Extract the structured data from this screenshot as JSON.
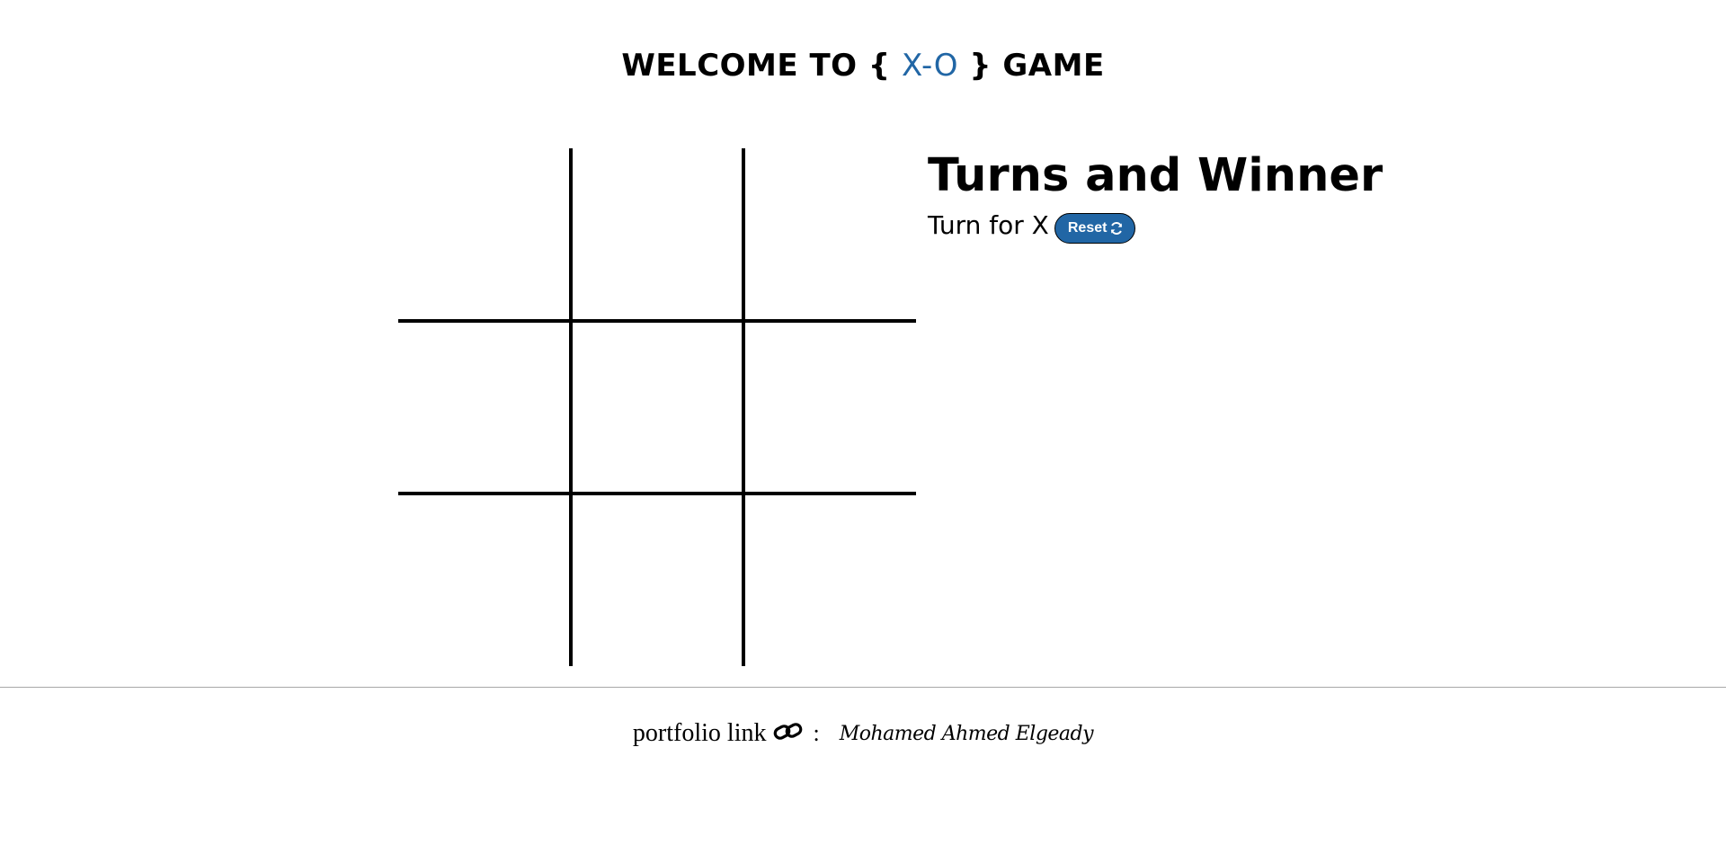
{
  "header": {
    "title_before": "WELCOME TO { ",
    "title_accent": "X-O",
    "title_after": " } GAME",
    "accent_color": "#2166a5"
  },
  "board": {
    "cells": [
      "",
      "",
      "",
      "",
      "",
      "",
      "",
      "",
      ""
    ]
  },
  "status_panel": {
    "heading": "Turns and Winner",
    "turn_text": "Turn for X",
    "reset_label": "Reset",
    "reset_icon": "refresh-icon",
    "button_color": "#2166a5"
  },
  "footer": {
    "label": "portfolio link",
    "link_icon": "link-icon",
    "separator": ":",
    "link_text": "Mohamed Ahmed Elgeady"
  }
}
